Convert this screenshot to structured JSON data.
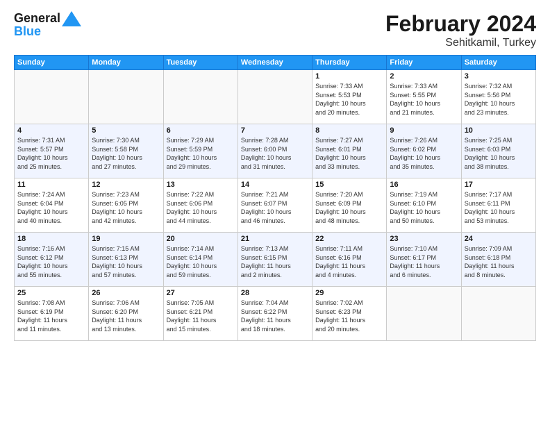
{
  "logo": {
    "line1": "General",
    "line2": "Blue"
  },
  "title": "February 2024",
  "subtitle": "Sehitkamil, Turkey",
  "days_of_week": [
    "Sunday",
    "Monday",
    "Tuesday",
    "Wednesday",
    "Thursday",
    "Friday",
    "Saturday"
  ],
  "weeks": [
    [
      {
        "day": "",
        "info": ""
      },
      {
        "day": "",
        "info": ""
      },
      {
        "day": "",
        "info": ""
      },
      {
        "day": "",
        "info": ""
      },
      {
        "day": "1",
        "info": "Sunrise: 7:33 AM\nSunset: 5:53 PM\nDaylight: 10 hours\nand 20 minutes."
      },
      {
        "day": "2",
        "info": "Sunrise: 7:33 AM\nSunset: 5:55 PM\nDaylight: 10 hours\nand 21 minutes."
      },
      {
        "day": "3",
        "info": "Sunrise: 7:32 AM\nSunset: 5:56 PM\nDaylight: 10 hours\nand 23 minutes."
      }
    ],
    [
      {
        "day": "4",
        "info": "Sunrise: 7:31 AM\nSunset: 5:57 PM\nDaylight: 10 hours\nand 25 minutes."
      },
      {
        "day": "5",
        "info": "Sunrise: 7:30 AM\nSunset: 5:58 PM\nDaylight: 10 hours\nand 27 minutes."
      },
      {
        "day": "6",
        "info": "Sunrise: 7:29 AM\nSunset: 5:59 PM\nDaylight: 10 hours\nand 29 minutes."
      },
      {
        "day": "7",
        "info": "Sunrise: 7:28 AM\nSunset: 6:00 PM\nDaylight: 10 hours\nand 31 minutes."
      },
      {
        "day": "8",
        "info": "Sunrise: 7:27 AM\nSunset: 6:01 PM\nDaylight: 10 hours\nand 33 minutes."
      },
      {
        "day": "9",
        "info": "Sunrise: 7:26 AM\nSunset: 6:02 PM\nDaylight: 10 hours\nand 35 minutes."
      },
      {
        "day": "10",
        "info": "Sunrise: 7:25 AM\nSunset: 6:03 PM\nDaylight: 10 hours\nand 38 minutes."
      }
    ],
    [
      {
        "day": "11",
        "info": "Sunrise: 7:24 AM\nSunset: 6:04 PM\nDaylight: 10 hours\nand 40 minutes."
      },
      {
        "day": "12",
        "info": "Sunrise: 7:23 AM\nSunset: 6:05 PM\nDaylight: 10 hours\nand 42 minutes."
      },
      {
        "day": "13",
        "info": "Sunrise: 7:22 AM\nSunset: 6:06 PM\nDaylight: 10 hours\nand 44 minutes."
      },
      {
        "day": "14",
        "info": "Sunrise: 7:21 AM\nSunset: 6:07 PM\nDaylight: 10 hours\nand 46 minutes."
      },
      {
        "day": "15",
        "info": "Sunrise: 7:20 AM\nSunset: 6:09 PM\nDaylight: 10 hours\nand 48 minutes."
      },
      {
        "day": "16",
        "info": "Sunrise: 7:19 AM\nSunset: 6:10 PM\nDaylight: 10 hours\nand 50 minutes."
      },
      {
        "day": "17",
        "info": "Sunrise: 7:17 AM\nSunset: 6:11 PM\nDaylight: 10 hours\nand 53 minutes."
      }
    ],
    [
      {
        "day": "18",
        "info": "Sunrise: 7:16 AM\nSunset: 6:12 PM\nDaylight: 10 hours\nand 55 minutes."
      },
      {
        "day": "19",
        "info": "Sunrise: 7:15 AM\nSunset: 6:13 PM\nDaylight: 10 hours\nand 57 minutes."
      },
      {
        "day": "20",
        "info": "Sunrise: 7:14 AM\nSunset: 6:14 PM\nDaylight: 10 hours\nand 59 minutes."
      },
      {
        "day": "21",
        "info": "Sunrise: 7:13 AM\nSunset: 6:15 PM\nDaylight: 11 hours\nand 2 minutes."
      },
      {
        "day": "22",
        "info": "Sunrise: 7:11 AM\nSunset: 6:16 PM\nDaylight: 11 hours\nand 4 minutes."
      },
      {
        "day": "23",
        "info": "Sunrise: 7:10 AM\nSunset: 6:17 PM\nDaylight: 11 hours\nand 6 minutes."
      },
      {
        "day": "24",
        "info": "Sunrise: 7:09 AM\nSunset: 6:18 PM\nDaylight: 11 hours\nand 8 minutes."
      }
    ],
    [
      {
        "day": "25",
        "info": "Sunrise: 7:08 AM\nSunset: 6:19 PM\nDaylight: 11 hours\nand 11 minutes."
      },
      {
        "day": "26",
        "info": "Sunrise: 7:06 AM\nSunset: 6:20 PM\nDaylight: 11 hours\nand 13 minutes."
      },
      {
        "day": "27",
        "info": "Sunrise: 7:05 AM\nSunset: 6:21 PM\nDaylight: 11 hours\nand 15 minutes."
      },
      {
        "day": "28",
        "info": "Sunrise: 7:04 AM\nSunset: 6:22 PM\nDaylight: 11 hours\nand 18 minutes."
      },
      {
        "day": "29",
        "info": "Sunrise: 7:02 AM\nSunset: 6:23 PM\nDaylight: 11 hours\nand 20 minutes."
      },
      {
        "day": "",
        "info": ""
      },
      {
        "day": "",
        "info": ""
      }
    ]
  ]
}
